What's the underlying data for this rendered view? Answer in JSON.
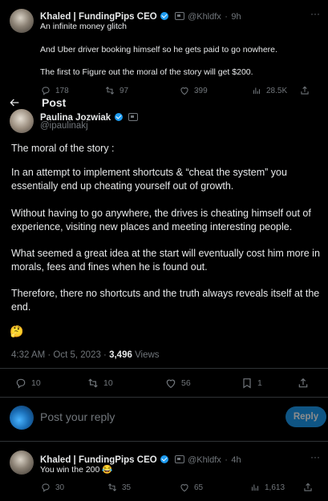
{
  "top_tweet": {
    "author_name": "Khaled | FundingPips CEO",
    "handle": "@Khldfx",
    "time": "9h",
    "lines": [
      "An infinite money glitch",
      "And Uber driver booking himself so he gets paid to go nowhere.",
      "The first to Figure out the moral of the story will get $200."
    ],
    "actions": {
      "replies": "178",
      "reposts": "97",
      "likes": "399",
      "views": "28.5K"
    }
  },
  "header": {
    "title": "Post",
    "back_icon": "arrow-left-icon"
  },
  "main_tweet": {
    "author_name": "Paulina Jozwiak",
    "handle": "@ipaulinakj",
    "paragraphs": [
      "The moral of the story :",
      "In an attempt to implement shortcuts & “cheat the system” you essentially end up cheating yourself out of growth.",
      "Without having to go anywhere, the drives is cheating himself out of experience, visiting new places and meeting interesting people.",
      "What seemed a great idea at the start will eventually cost him more in morals, fees and fines when he is found out.",
      "Therefore, there no shortcuts and the truth always reveals itself at the end."
    ],
    "emoji": "🤔",
    "timestamp": "4:32 AM · Oct 5, 2023 · ",
    "views_count": "3,496",
    "views_label": " Views",
    "actions": {
      "replies": "10",
      "reposts": "10",
      "likes": "56",
      "bookmarks": "1"
    }
  },
  "reply_box": {
    "placeholder": "Post your reply",
    "button_label": "Reply"
  },
  "reply_tweet": {
    "author_name": "Khaled | FundingPips CEO",
    "handle": "@Khldfx",
    "time": "4h",
    "text": "You win the 200 😂",
    "actions": {
      "replies": "30",
      "reposts": "35",
      "likes": "65",
      "views": "1,613"
    }
  },
  "colors": {
    "accent": "#1d9bf0",
    "muted": "#71767b",
    "text": "#e7e9ea",
    "background": "#000000"
  }
}
